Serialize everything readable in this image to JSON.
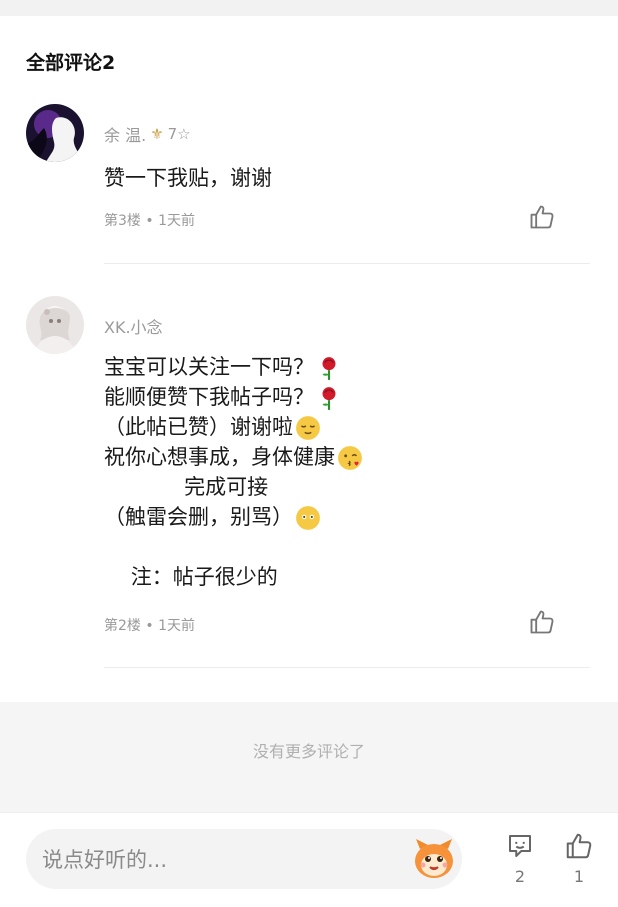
{
  "section": {
    "title": "全部评论2"
  },
  "comments": [
    {
      "username": "余 温.",
      "level": "7☆",
      "body_lines": [
        "赞一下我贴，谢谢"
      ],
      "meta": "第3楼 • 1天前"
    },
    {
      "username": "XK.小念",
      "body_lines": [
        "宝宝可以关注一下吗？",
        "能顺便赞下我帖子吗？",
        "（此帖已赞）谢谢啦",
        "祝你心想事成，身体健康",
        "            完成可接",
        "（触雷会删，别骂）",
        "",
        "    注：帖子很少的"
      ],
      "meta": "第2楼 • 1天前"
    }
  ],
  "footer": {
    "no_more_text": "没有更多评论了"
  },
  "bottom_bar": {
    "input_placeholder": "说点好听的...",
    "comment_count": "2",
    "like_count": "1"
  },
  "icons": {
    "like": "thumbs-up-icon",
    "comment": "comment-bubble-icon",
    "badge": "fleur-de-lis-icon",
    "emoji_rose": "rose-emoji",
    "emoji_relieved": "relieved-face-emoji",
    "emoji_kiss": "kissing-face-emoji",
    "emoji_speechless": "no-mouth-face-emoji",
    "mascot": "orange-mascot-icon"
  },
  "colors": {
    "meta_text": "#9a9a9a",
    "badge_gold": "#c9a24a",
    "footer_bg": "#f5f5f5",
    "input_bg": "#f3f3f3"
  }
}
